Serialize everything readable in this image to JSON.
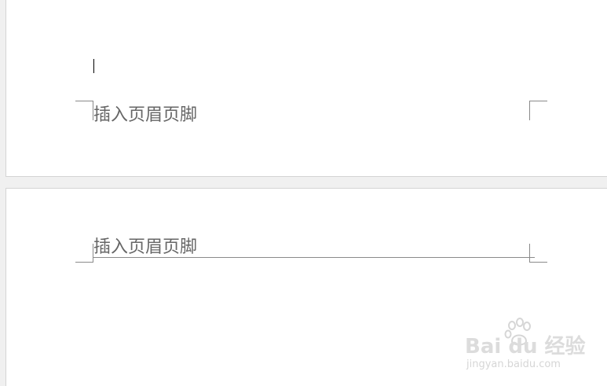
{
  "document": {
    "pages": [
      {
        "footer_placeholder": "插入页眉页脚"
      },
      {
        "header_placeholder": "插入页眉页脚"
      }
    ]
  },
  "watermark": {
    "logo_text": "Bai du 经验",
    "url": "jingyan.baidu.com",
    "icon": "paw-icon",
    "color": "#d9d9d9"
  },
  "colors": {
    "background": "#f0f0f0",
    "page": "#ffffff",
    "placeholder_text": "#666666",
    "crop_marks": "#8a8a8a"
  }
}
